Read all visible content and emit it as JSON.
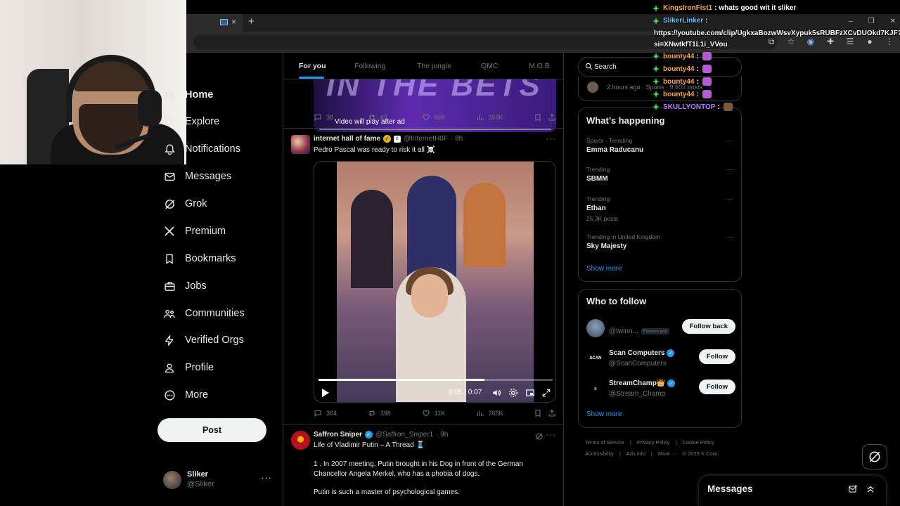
{
  "browser": {
    "tab_close": "×",
    "new_tab": "+",
    "window_controls": [
      "–",
      "❐",
      "✕"
    ]
  },
  "nav": {
    "items": [
      {
        "label": "Home",
        "icon": "home-icon"
      },
      {
        "label": "Explore",
        "icon": "search-icon"
      },
      {
        "label": "Notifications",
        "icon": "bell-icon"
      },
      {
        "label": "Messages",
        "icon": "envelope-icon"
      },
      {
        "label": "Grok",
        "icon": "grok-icon"
      },
      {
        "label": "Premium",
        "icon": "x-logo-icon"
      },
      {
        "label": "Bookmarks",
        "icon": "bookmark-icon"
      },
      {
        "label": "Jobs",
        "icon": "briefcase-icon"
      },
      {
        "label": "Communities",
        "icon": "people-icon"
      },
      {
        "label": "Verified Orgs",
        "icon": "lightning-icon"
      },
      {
        "label": "Profile",
        "icon": "person-icon"
      },
      {
        "label": "More",
        "icon": "more-circle-icon"
      }
    ],
    "post_label": "Post",
    "account": {
      "name": "Sliker",
      "handle": "@Sliker",
      "more": "···"
    }
  },
  "feed": {
    "tabs": [
      "For you",
      "Following",
      "The jungle",
      "QMC",
      "M.O.B"
    ],
    "tweet1": {
      "overlay": "Video will play after ad",
      "banner": "IN THE BETS",
      "stats": {
        "replies": "38",
        "reposts": "63",
        "likes": "868",
        "views": "358K"
      }
    },
    "tweet2": {
      "name": "internet hall of fame",
      "handle": "@InternetH0F",
      "time": "· 8h",
      "text": "Pedro Pascal was ready to risk it all ☠️",
      "video_time": "0:05 / 0:07",
      "progress": 0.71,
      "stats": {
        "replies": "364",
        "reposts": "398",
        "likes": "11K",
        "views": "765K"
      }
    },
    "tweet3": {
      "name": "Saffron Sniper",
      "handle": "@Saffron_Sniper1",
      "time": "· 9h",
      "line1": "Life of Vladimir Putin – A Thread 🧵",
      "line2": "1 . In 2007 meeting, Putin brought in his Dog in front of the German Chancellor Angela Merkel, who has a phobia of dogs.",
      "line3": "Putin is such a master of psychological games."
    }
  },
  "right": {
    "search_placeholder": "Search",
    "prev_meta": "2 hours ago · Sports · 9,603 posts",
    "happening_title": "What’s happening",
    "trends": [
      {
        "meta": "Sports · Trending",
        "name": "Emma Raducanu",
        "posts": ""
      },
      {
        "meta": "Trending",
        "name": "SBMM",
        "posts": ""
      },
      {
        "meta": "Trending",
        "name": "Ethan",
        "posts": "25.3K posts"
      },
      {
        "meta": "Trending in United Kingdom",
        "name": "Sky Majesty",
        "posts": ""
      }
    ],
    "show_more": "Show more",
    "follow_title": "Who to follow",
    "follow": [
      {
        "name": "",
        "handle": "@twinn...",
        "badge": "Follows you",
        "button": "Follow back"
      },
      {
        "name": "Scan Computers",
        "handle": "@ScanComputers",
        "badge": "",
        "button": "Follow"
      },
      {
        "name": "StreamChamp👑",
        "handle": "@Stream_Champ",
        "badge": "",
        "button": "Follow"
      }
    ],
    "footer": [
      "Terms of Service",
      "|",
      "Privacy Policy",
      "|",
      "Cookie Policy",
      "|",
      "Accessibility",
      "|",
      "Ads info",
      "|",
      "More ···",
      "© 2025 X Corp."
    ],
    "messages_title": "Messages"
  },
  "chat": {
    "lines": [
      {
        "user": "KingsIronFist1",
        "sep": ":",
        "msg": "whats good wit it sliker",
        "color": "#f4a84a"
      },
      {
        "user": "SlikerLinker",
        "sep": ":",
        "msg": "",
        "color": "#6ec6ff"
      },
      {
        "user": "bounty44",
        "sep": ":",
        "msg": "",
        "color": "#f4a84a"
      },
      {
        "user": "bounty44",
        "sep": ":",
        "msg": "",
        "color": "#f4a84a"
      },
      {
        "user": "bounty44",
        "sep": ":",
        "msg": "",
        "color": "#f4a84a"
      },
      {
        "user": "bounty44",
        "sep": ":",
        "msg": "",
        "color": "#f4a84a"
      },
      {
        "user": "SKULLYONTOP",
        "sep": ":",
        "msg": "",
        "color": "#b57cff"
      }
    ],
    "link_line1": "https://youtube.com/clip/UgkxaBozwWsvXypuk5sRUBFzXCvDUOkd7KJF?",
    "link_line2": "si=XNwtkfT1L1i_VVou"
  },
  "colors": {
    "accent": "#1d9bf0",
    "bg": "#000000",
    "border": "#2f3336",
    "muted": "#71767b",
    "chat_badge": "#3ddc4a"
  }
}
